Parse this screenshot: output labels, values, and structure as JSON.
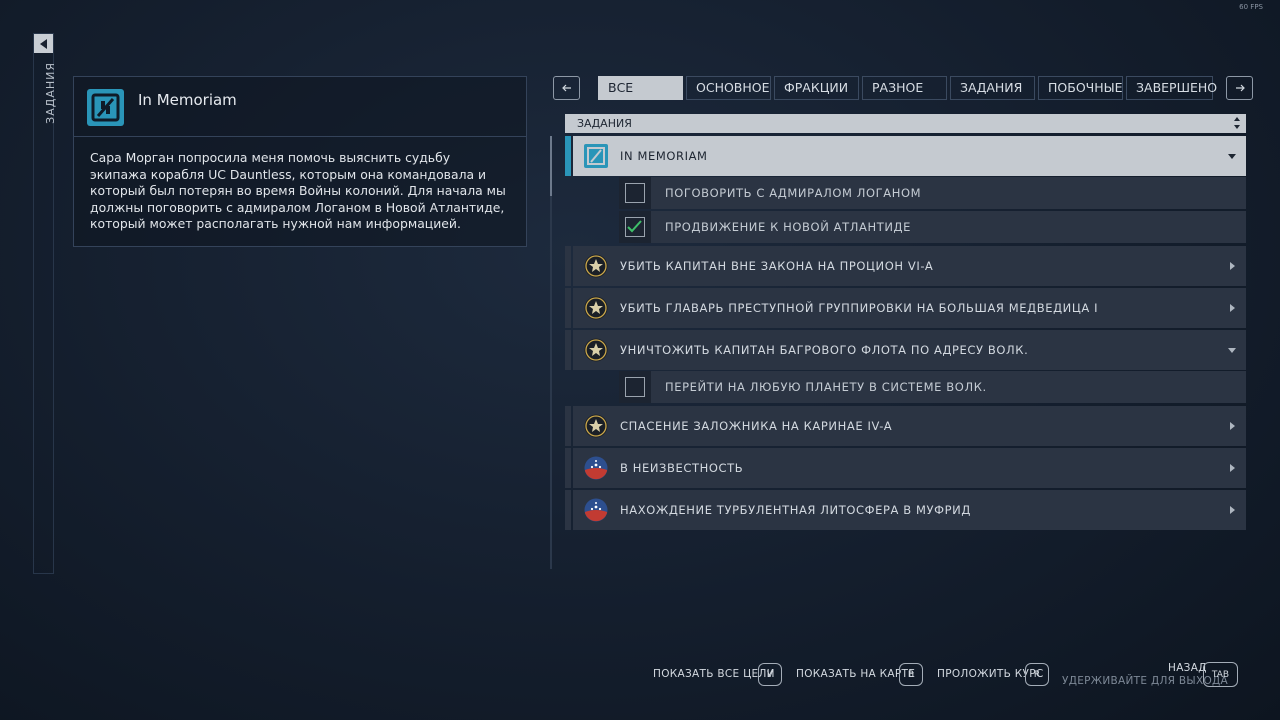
{
  "fps": "60 FPS",
  "side": {
    "label": "ЗАДАНИЯ",
    "back_icon": "arrow-left-icon"
  },
  "detail": {
    "title": "In Memoriam",
    "icon": "memoriam-mission-icon",
    "body": "Сара Морган попросила меня помочь выяснить судьбу экипажа корабля UC Dauntless, которым она командовала и который был потерян во время Войны колоний. Для начала мы должны поговорить с адмиралом Логаном в Новой Атлантиде, который может располагать нужной нам информацией."
  },
  "tabs": [
    {
      "label": "ВСЕ",
      "active": true
    },
    {
      "label": "ОСНОВНОЕ",
      "active": false
    },
    {
      "label": "ФРАКЦИИ",
      "active": false
    },
    {
      "label": "РАЗНОЕ",
      "active": false
    },
    {
      "label": "ЗАДАНИЯ",
      "active": false
    },
    {
      "label": "ПОБОЧНЫЕ",
      "active": false
    },
    {
      "label": "ЗАВЕРШЕНО",
      "active": false
    }
  ],
  "list": {
    "header": "ЗАДАНИЯ",
    "missions": [
      {
        "label": "IN MEMORIAM",
        "icon": "memoriam-mission-icon",
        "expanded": true,
        "active": true,
        "objectives": [
          {
            "label": "ПОГОВОРИТЬ С АДМИРАЛОМ ЛОГАНОМ",
            "done": false
          },
          {
            "label": "ПРОДВИЖЕНИЕ К НОВОЙ АТЛАНТИДЕ",
            "done": true
          }
        ]
      },
      {
        "label": "УБИТЬ КАПИТАН ВНЕ ЗАКОНА НА ПРОЦИОН VI-A",
        "icon": "bounty-emblem-icon",
        "expanded": false
      },
      {
        "label": "УБИТЬ ГЛАВАРЬ ПРЕСТУПНОЙ ГРУППИРОВКИ НА БОЛЬШАЯ МЕДВЕДИЦА I",
        "icon": "bounty-emblem-icon",
        "expanded": false
      },
      {
        "label": "УНИЧТОЖИТЬ КАПИТАН БАГРОВОГО ФЛОТА ПО АДРЕСУ ВОЛК.",
        "icon": "bounty-emblem-icon",
        "expanded": true,
        "objectives": [
          {
            "label": "ПЕРЕЙТИ НА ЛЮБУЮ ПЛАНЕТУ В СИСТЕМЕ ВОЛК.",
            "done": false
          }
        ]
      },
      {
        "label": "СПАСЕНИЕ ЗАЛОЖНИКА НА КАРИНАЕ IV-A",
        "icon": "bounty-emblem-icon",
        "expanded": false
      },
      {
        "label": "В НЕИЗВЕСТНОСТЬ",
        "icon": "united-colonies-icon",
        "expanded": false
      },
      {
        "label": "НАХОЖДЕНИЕ ТУРБУЛЕНТНАЯ ЛИТОСФЕРА В МУФРИД",
        "icon": "united-colonies-icon",
        "expanded": false
      }
    ]
  },
  "hints": {
    "show_all": {
      "label": "ПОКАЗАТЬ ВСЕ ЦЕЛИ",
      "key": "V"
    },
    "show_map": {
      "label": "ПОКАЗАТЬ НА КАРТЕ",
      "key": "B"
    },
    "set_course": {
      "label": "ПРОЛОЖИТЬ КУРС",
      "key": "R"
    },
    "back": {
      "label": "НАЗАД",
      "sub": "УДЕРЖИВАЙТЕ ДЛЯ ВЫХОДА",
      "key": "TAB"
    }
  },
  "colors": {
    "accent": "#2a95b8",
    "check": "#3fbf6a",
    "panel": "#2b3443",
    "highlight": "#c5cad0"
  }
}
